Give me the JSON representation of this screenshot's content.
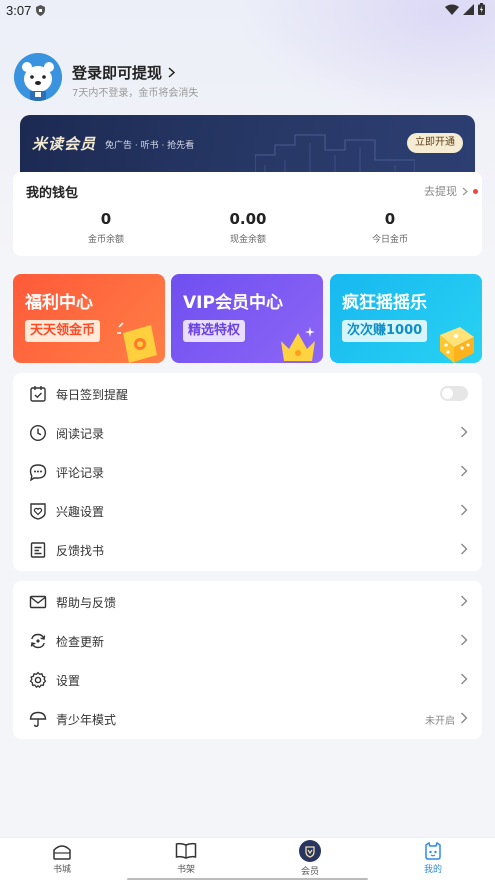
{
  "status": {
    "time": "3:07"
  },
  "profile": {
    "title": "登录即可提现",
    "subtitle": "7天内不登录，金币将会消失"
  },
  "vip_banner": {
    "name": "米读会员",
    "desc": "免广告 · 听书 · 抢先看",
    "button": "立即开通"
  },
  "wallet": {
    "title": "我的钱包",
    "withdraw": "去提现",
    "stats": [
      {
        "value": "0",
        "label": "金币余额"
      },
      {
        "value": "0.00",
        "label": "现金余额"
      },
      {
        "value": "0",
        "label": "今日金币"
      }
    ]
  },
  "cards": [
    {
      "title": "福利中心",
      "tag": "天天领金币",
      "color": "#ff6a3d"
    },
    {
      "title": "VIP会员中心",
      "tag": "精选特权",
      "color": "#7b5cf2"
    },
    {
      "title": "疯狂摇摇乐",
      "tag": "次次赚1000",
      "color": "#1ec4f0"
    }
  ],
  "list1": [
    {
      "label": "每日签到提醒",
      "icon": "calendar-check-icon"
    },
    {
      "label": "阅读记录",
      "icon": "clock-icon"
    },
    {
      "label": "评论记录",
      "icon": "chat-bubble-icon"
    },
    {
      "label": "兴趣设置",
      "icon": "heart-shield-icon"
    },
    {
      "label": "反馈找书",
      "icon": "document-icon"
    }
  ],
  "list2": [
    {
      "label": "帮助与反馈",
      "icon": "mail-icon"
    },
    {
      "label": "检查更新",
      "icon": "refresh-icon"
    },
    {
      "label": "设置",
      "icon": "gear-icon"
    },
    {
      "label": "青少年模式",
      "icon": "umbrella-icon",
      "value": "未开启"
    }
  ],
  "nav": [
    {
      "label": "书城",
      "icon": "bookstore-icon"
    },
    {
      "label": "书架",
      "icon": "bookshelf-icon"
    },
    {
      "label": "会员",
      "icon": "vip-icon"
    },
    {
      "label": "我的",
      "icon": "profile-icon",
      "active": true
    }
  ],
  "colors": {
    "accent": "#2f8ce6",
    "vip_banner": "#1c2a52"
  }
}
